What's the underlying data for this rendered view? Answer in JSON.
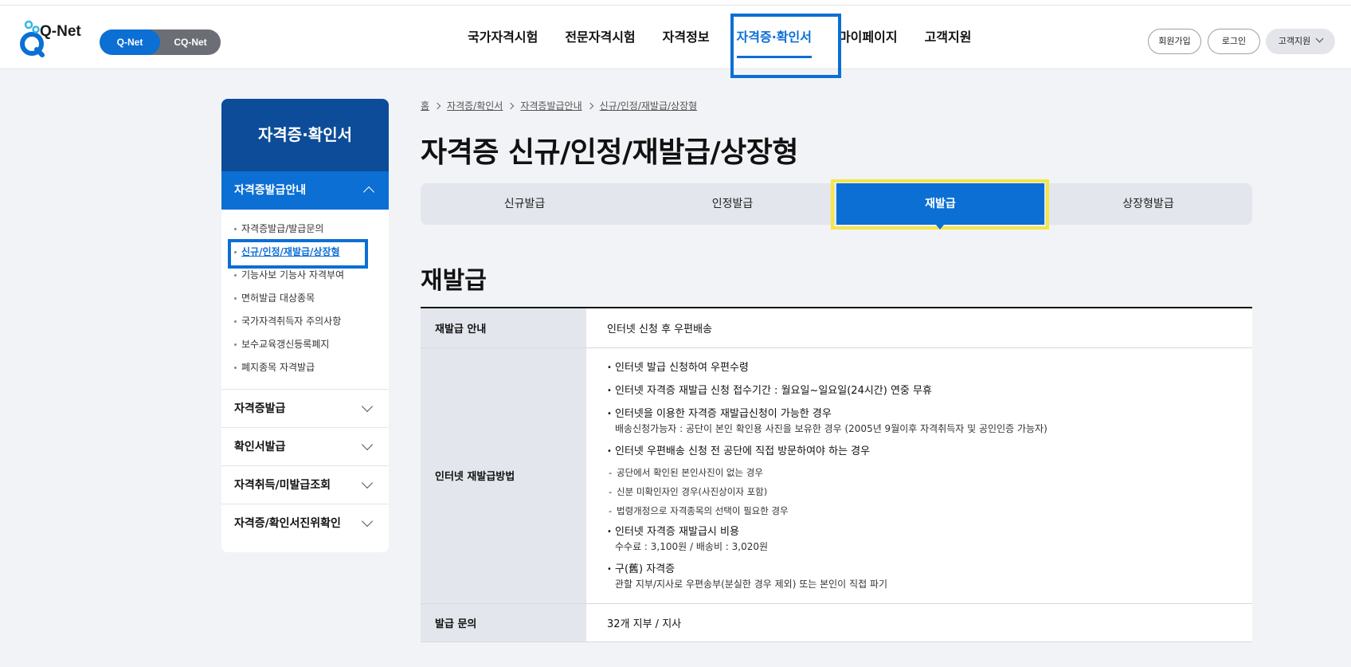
{
  "header": {
    "logo_text": "Q-Net",
    "switch": {
      "on_label": "Q-Net",
      "off_label": "CQ-Net"
    },
    "nav": [
      "국가자격시험",
      "전문자격시험",
      "자격정보",
      "자격증·확인서",
      "마이페이지",
      "고객지원"
    ],
    "nav_active_index": 3,
    "util": {
      "join": "회원가입",
      "login": "로그인",
      "support": "고객지원"
    }
  },
  "sidebar": {
    "title": "자격증·확인서",
    "active_group": "자격증발급안내",
    "sub_items": [
      "자격증발급/발급문의",
      "신규/인정/재발급/상장형",
      "기능사보 기능사 자격부여",
      "면허발급 대상종목",
      "국가자격취득자 주의사항",
      "보수교육갱신등록폐지",
      "폐지종목 자격발급"
    ],
    "current_sub_index": 1,
    "groups": [
      "자격증발급",
      "확인서발급",
      "자격취득/미발급조회",
      "자격증/확인서진위확인"
    ]
  },
  "breadcrumb": [
    "홈",
    "자격증/확인서",
    "자격증발급안내",
    "신규/인정/재발급/상장형"
  ],
  "page_title": "자격증 신규/인정/재발급/상장형",
  "tabs": [
    "신규발급",
    "인정발급",
    "재발급",
    "상장형발급"
  ],
  "active_tab_index": 2,
  "section_title": "재발급",
  "table": {
    "row1": {
      "label": "재발급 안내",
      "value": "인터넷 신청 후 우편배송"
    },
    "row2": {
      "label": "인터넷 재발급방법",
      "bullets": [
        {
          "text": "인터넷 발급 신청하여 우편수령"
        },
        {
          "text": "인터넷 자격증 재발급 신청 접수기간 : 월요일~일요일(24시간) 연중 무휴"
        },
        {
          "text": "인터넷을 이용한 자격증 재발급신청이 가능한 경우",
          "sub": "배송신청가능자 : 공단이 본인 확인용 사진을 보유한 경우 (2005년 9월이후 자격취득자 및 공인인증 가능자)"
        },
        {
          "text": "인터넷 우편배송 신청 전 공단에 직접 방문하여야 하는 경우"
        }
      ],
      "dashes": [
        "공단에서 확인된 본인사진이 없는 경우",
        "신분 미확인자인 경우(사진상이자 포함)",
        "법령개정으로 자격종목의 선택이 필요한 경우"
      ],
      "bullets2": [
        {
          "text": "인터넷 자격증 재발급시 비용",
          "sub": "수수료 : 3,100원 / 배송비 : 3,020원"
        },
        {
          "text": "구(舊) 자격증",
          "sub": "관할 지부/지사로 우편송부(분실한 경우 제외) 또는 본인이 직접 파기"
        }
      ]
    },
    "row3": {
      "label": "발급 문의",
      "value": "32개 지부 / 지사"
    }
  },
  "colors": {
    "primary": "#0b6fd4",
    "sidebar_title_bg": "#0c4c98",
    "highlight_yellow": "#f3e646"
  }
}
